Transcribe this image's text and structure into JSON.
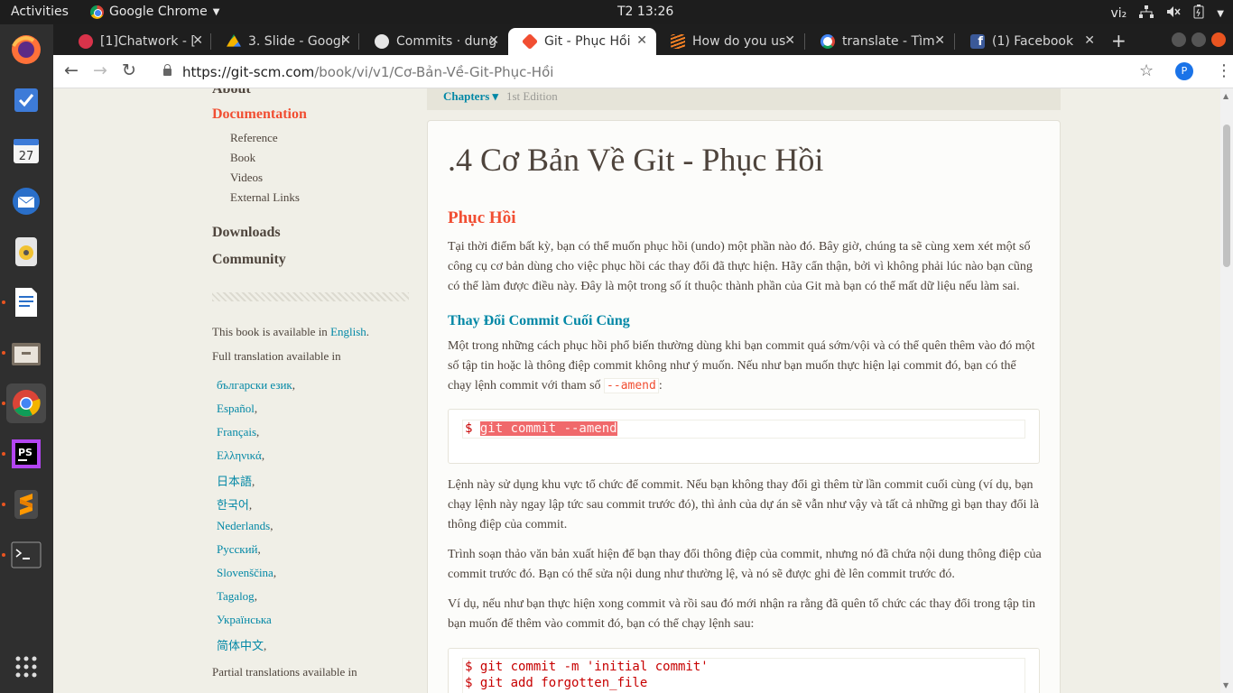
{
  "topbar": {
    "activities": "Activities",
    "app_name": "Google Chrome",
    "clock": "T2 13:26",
    "ime": "vi₂"
  },
  "tabs": [
    {
      "label": "[1]Chatwork - [",
      "favicon_color": "#d9334a"
    },
    {
      "label": "3. Slide - Googl",
      "favicon_color": "#f4b400"
    },
    {
      "label": "Commits · dung",
      "favicon_color": "#e6e6e6"
    },
    {
      "label": "Git - Phục Hồi",
      "favicon_color": "#f14e32"
    },
    {
      "label": "How do you us",
      "favicon_color": "#f48024"
    },
    {
      "label": "translate - Tìm",
      "favicon_color": "#4285f4"
    },
    {
      "label": "(1) Facebook",
      "favicon_color": "#3b5998"
    }
  ],
  "toolbar": {
    "url_host": "https://git-scm.com",
    "url_path": "/book/vi/v1/Cơ-Bản-Về-Git-Phục-Hồi",
    "profile_initial": "P"
  },
  "sidebar": {
    "about_cut": "About",
    "documentation": "Documentation",
    "doc_items": [
      "Reference",
      "Book",
      "Videos",
      "External Links"
    ],
    "downloads": "Downloads",
    "community": "Community",
    "available_prefix": "This book is available in ",
    "available_link": "English",
    "full_translation": "Full translation available in",
    "languages": [
      "български език",
      "Español",
      "Français",
      "Ελληνικά",
      "日本語",
      "한국어",
      "Nederlands",
      "Русский",
      "Slovenščina",
      "Tagalog",
      "Українська",
      "简体中文"
    ],
    "partial_translation": "Partial translations available in"
  },
  "content": {
    "chapters": "Chapters ▾",
    "edition": "1st Edition",
    "title": ".4 Cơ Bản Về Git - Phục Hồi",
    "h2": "Phục Hồi",
    "p1": "Tại thời điểm bất kỳ, bạn có thể muốn phục hồi (undo) một phần nào đó. Bây giờ, chúng ta sẽ cùng xem xét một số công cụ cơ bản dùng cho việc phục hồi các thay đổi đã thực hiện. Hãy cẩn thận, bởi vì không phải lúc nào bạn cũng có thể làm được điều này. Đây là một trong số ít thuộc thành phần của Git mà bạn có thể mất dữ liệu nếu làm sai.",
    "h3": "Thay Đổi Commit Cuối Cùng",
    "p2": "Một trong những cách phục hồi phổ biến thường dùng khi bạn commit quá sớm/vội và có thể quên thêm vào đó một số tập tin hoặc là thông điệp commit không như ý muốn. Nếu như bạn muốn thực hiện lại commit đó, bạn có thể chạy lệnh commit với tham số ",
    "p2_code": "--amend",
    "p2_end": ":",
    "code1_prompt": "$ ",
    "code1_cmd": "git commit --amend",
    "p3": "Lệnh này sử dụng khu vực tổ chức để commit. Nếu bạn không thay đổi gì thêm từ lần commit cuối cùng (ví dụ, bạn chạy lệnh này ngay lập tức sau commit trước đó), thì ảnh của dự án sẽ vẫn như vậy và tất cả những gì bạn thay đổi là thông điệp của commit.",
    "p4": "Trình soạn thảo văn bản xuất hiện để bạn thay đổi thông điệp của commit, nhưng nó đã chứa nội dung thông điệp của commit trước đó. Bạn có thể sửa nội dung như thường lệ, và nó sẽ được ghi đè lên commit trước đó.",
    "p5": "Ví dụ, nếu như bạn thực hiện xong commit và rồi sau đó mới nhận ra rằng đã quên tổ chức các thay đổi trong tập tin bạn muốn để thêm vào commit đó, bạn có thể chạy lệnh sau:",
    "code2_line1": "$ git commit -m 'initial commit'",
    "code2_line2": "$ git add forgotten_file"
  }
}
